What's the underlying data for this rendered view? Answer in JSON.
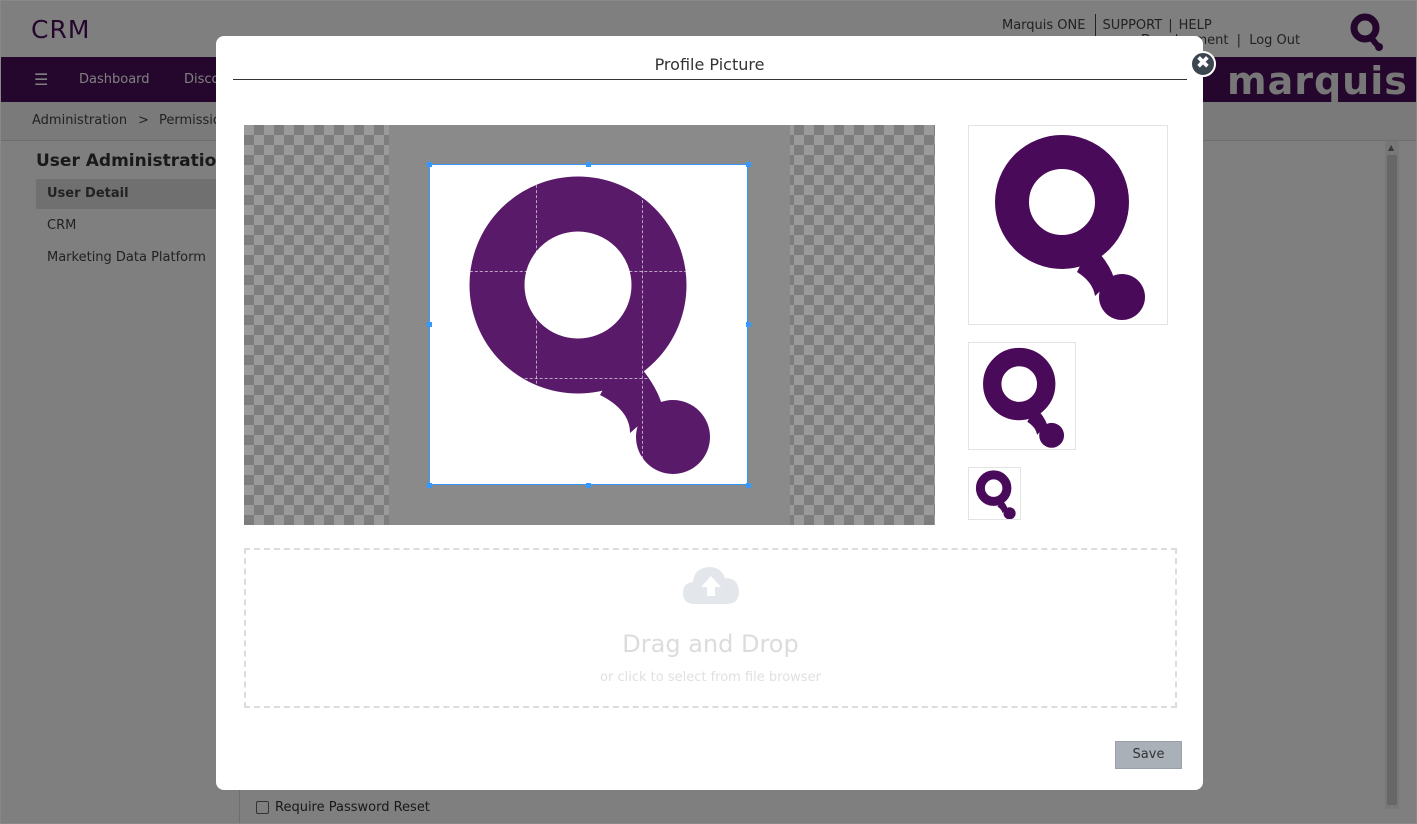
{
  "app": {
    "title": "CRM",
    "brand": "marquis"
  },
  "top_links": {
    "marquis_one": "Marquis ONE",
    "support": "SUPPORT",
    "help": "HELP",
    "bar": "|",
    "env": "Development",
    "logout": "Log Out"
  },
  "nav": {
    "items": [
      "Dashboard",
      "Discover"
    ]
  },
  "breadcrumb": {
    "items": [
      "Administration",
      "Permissions"
    ],
    "separator": ">"
  },
  "sidebar": {
    "title": "User Administration",
    "items": [
      {
        "label": "User Detail",
        "active": true
      },
      {
        "label": "CRM",
        "active": false
      },
      {
        "label": "Marketing Data Platform",
        "active": false
      }
    ]
  },
  "form": {
    "require_password_reset": "Require Password Reset",
    "require_password_reset_checked": false
  },
  "modal": {
    "title": "Profile Picture",
    "close_icon": "✖",
    "dropzone": {
      "title": "Drag and Drop",
      "subtitle": "or click to select from file browser"
    },
    "save_label": "Save"
  },
  "colors": {
    "brand_purple": "#4b0d5b",
    "logo_purple": "#5a1a6a",
    "preview_purple": "#4a0a5a",
    "nav_bg": "#4b0d5b",
    "crop_border": "#3399ff"
  }
}
